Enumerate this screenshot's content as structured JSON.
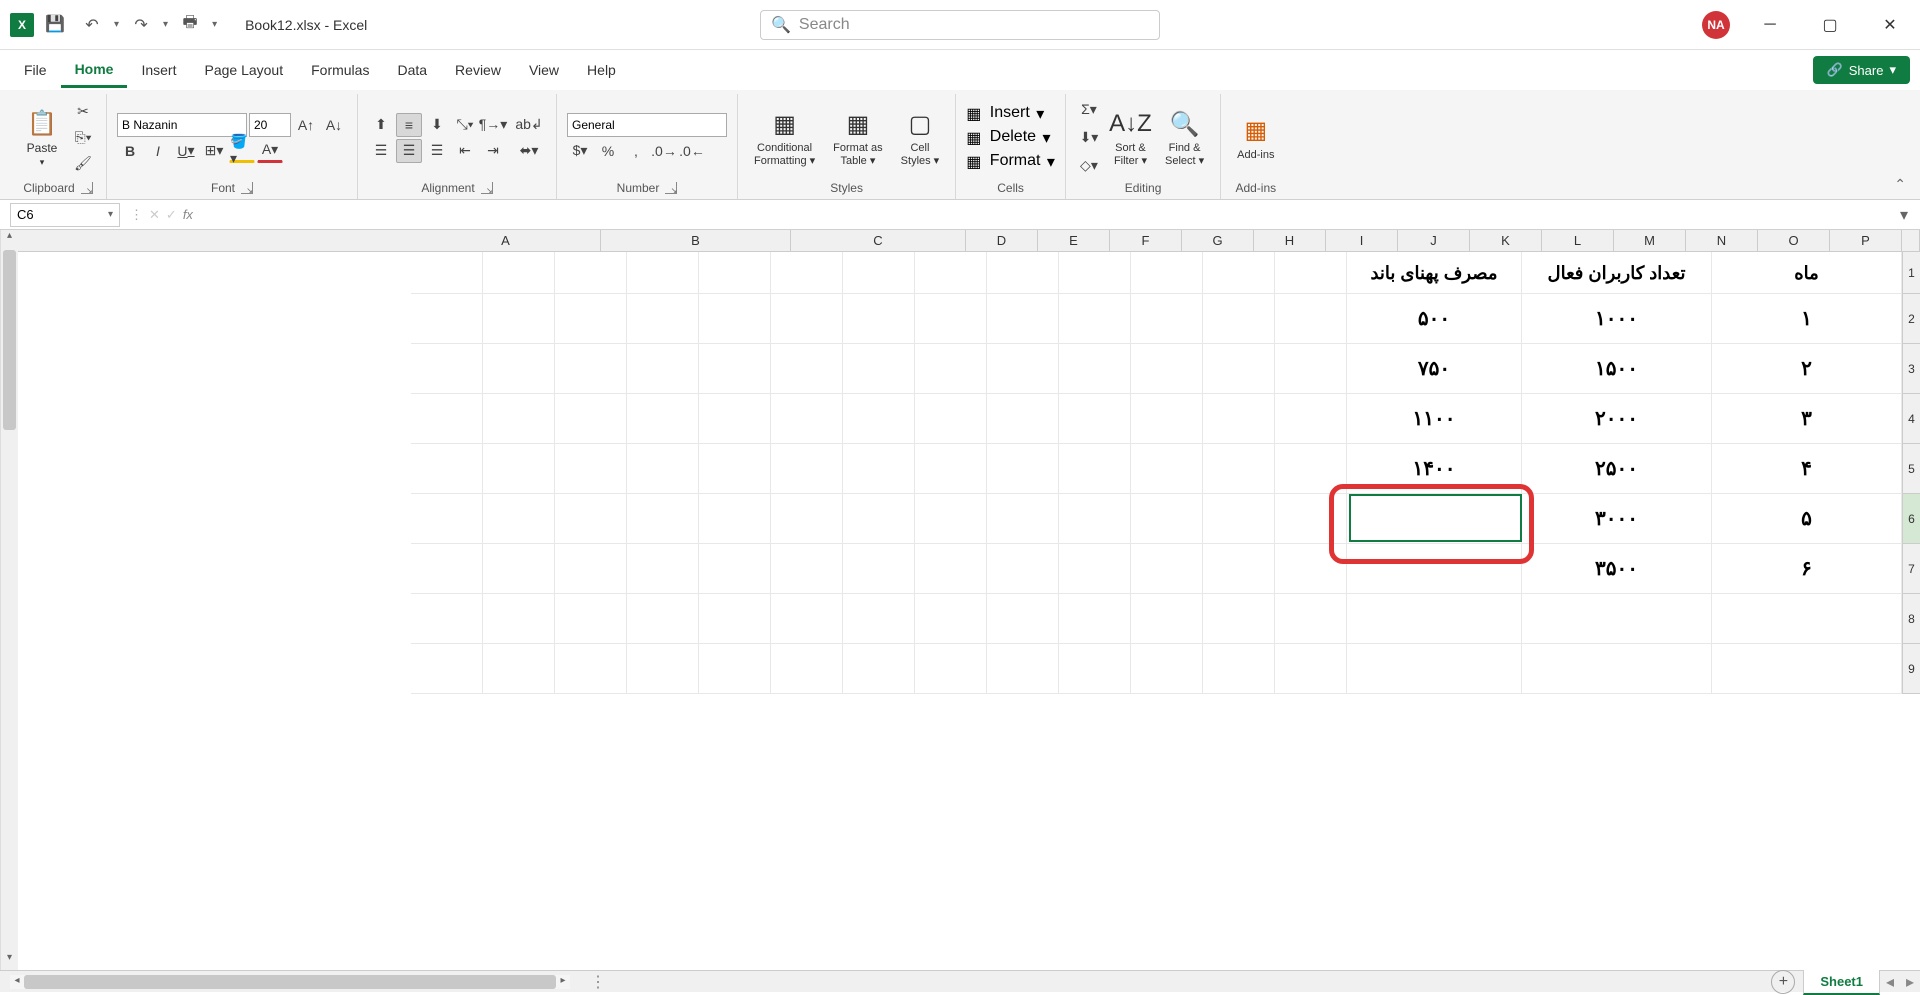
{
  "titlebar": {
    "filename": "Book12.xlsx - Excel",
    "search_placeholder": "Search",
    "user_initials": "NA"
  },
  "tabs": {
    "file": "File",
    "home": "Home",
    "insert": "Insert",
    "page_layout": "Page Layout",
    "formulas": "Formulas",
    "data": "Data",
    "review": "Review",
    "view": "View",
    "help": "Help",
    "share": "Share"
  },
  "ribbon": {
    "clipboard": {
      "label": "Clipboard",
      "paste": "Paste"
    },
    "font": {
      "label": "Font",
      "name": "B Nazanin",
      "size": "20",
      "bold": "B",
      "italic": "I",
      "underline": "U"
    },
    "alignment": {
      "label": "Alignment"
    },
    "number": {
      "label": "Number",
      "format": "General"
    },
    "styles": {
      "label": "Styles",
      "conditional": "Conditional Formatting",
      "table": "Format as Table",
      "cell": "Cell Styles"
    },
    "cells": {
      "label": "Cells",
      "insert": "Insert",
      "delete": "Delete",
      "format": "Format"
    },
    "editing": {
      "label": "Editing",
      "sort": "Sort & Filter",
      "find": "Find & Select"
    },
    "addins": {
      "label": "Add-ins",
      "btn": "Add-ins"
    }
  },
  "namebox": "C6",
  "fx_label": "fx",
  "columns": [
    "A",
    "B",
    "C",
    "D",
    "E",
    "F",
    "G",
    "H",
    "I",
    "J",
    "K",
    "L",
    "M",
    "N",
    "O",
    "P"
  ],
  "col_widths": {
    "A": 190,
    "B": 190,
    "C": 175,
    "other": 72
  },
  "rows": [
    "1",
    "2",
    "3",
    "4",
    "5",
    "6",
    "7",
    "8",
    "9"
  ],
  "row_heights": {
    "1": 42,
    "other": 50
  },
  "data_cells": {
    "header": {
      "A": "ماه",
      "B": "تعداد کاربران فعال",
      "C": "مصرف پهنای باند"
    },
    "r2": {
      "A": "۱",
      "B": "۱۰۰۰",
      "C": "۵۰۰"
    },
    "r3": {
      "A": "۲",
      "B": "۱۵۰۰",
      "C": "۷۵۰"
    },
    "r4": {
      "A": "۳",
      "B": "۲۰۰۰",
      "C": "۱۱۰۰"
    },
    "r5": {
      "A": "۴",
      "B": "۲۵۰۰",
      "C": "۱۴۰۰"
    },
    "r6": {
      "A": "۵",
      "B": "۳۰۰۰",
      "C": ""
    },
    "r7": {
      "A": "۶",
      "B": "۳۵۰۰",
      "C": ""
    }
  },
  "active_cell": "C6",
  "sheet": {
    "name": "Sheet1"
  }
}
